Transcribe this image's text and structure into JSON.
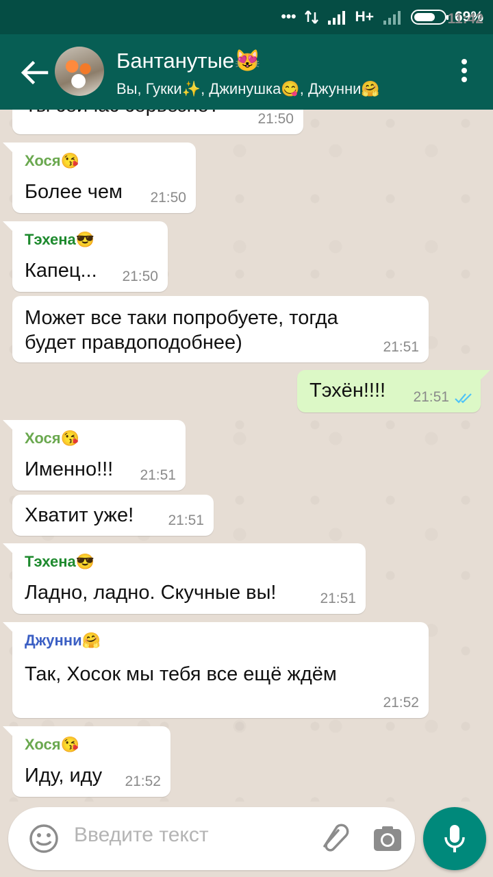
{
  "status_bar": {
    "time": "11:42",
    "network": "H+",
    "battery": "69%",
    "icons": [
      "dots-icon",
      "data-transfer-icon",
      "signal-icon",
      "battery-icon"
    ]
  },
  "header": {
    "title": "Бантанутые😻",
    "subtitle": "Вы, Гукки✨, Джинушка😋, Джунни🤗",
    "back_icon": "back-arrow-icon",
    "menu_icon": "more-vert-icon"
  },
  "messages": [
    {
      "direction": "in",
      "sender": "",
      "text": "Ты сейчас серьезно?",
      "time": "21:50"
    },
    {
      "direction": "in",
      "sender": "Хося😘",
      "sender_color": "#6aa84f",
      "text": "Более чем",
      "time": "21:50"
    },
    {
      "direction": "in",
      "sender": "Тэхена😎",
      "sender_color": "#1e8a2e",
      "text": "Капец...",
      "time": "21:50"
    },
    {
      "direction": "in",
      "sender": "",
      "text_line1": "Может все таки попробуете, тогда",
      "text_line2": "будет правдоподобнее)",
      "time": "21:51"
    },
    {
      "direction": "out",
      "sender": "",
      "text": "Тэхён!!!!",
      "time": "21:51",
      "status": "read"
    },
    {
      "direction": "in",
      "sender": "Хося😘",
      "sender_color": "#6aa84f",
      "text": "Именно!!!",
      "time": "21:51"
    },
    {
      "direction": "in",
      "sender": "",
      "text": "Хватит уже!",
      "time": "21:51"
    },
    {
      "direction": "in",
      "sender": "Тэхена😎",
      "sender_color": "#1e8a2e",
      "text": "Ладно, ладно. Скучные вы!",
      "time": "21:51"
    },
    {
      "direction": "in",
      "sender": "Джунни🤗",
      "sender_color": "#3b5fc4",
      "text": "Так, Хосок мы тебя все ещё ждём",
      "time": "21:52"
    },
    {
      "direction": "in",
      "sender": "Хося😘",
      "sender_color": "#6aa84f",
      "text": "Иду, иду",
      "time": "21:52"
    }
  ],
  "composer": {
    "placeholder": "Введите текст",
    "icons": [
      "emoji-icon",
      "paperclip-icon",
      "camera-icon",
      "mic-icon"
    ]
  },
  "colors": {
    "app_bar": "#075e54",
    "status_bar": "#054d44",
    "outgoing_bubble": "#dcf8c6",
    "incoming_bubble": "#ffffff",
    "read_ticks": "#4fc3f7",
    "mic_button": "#00897b"
  }
}
